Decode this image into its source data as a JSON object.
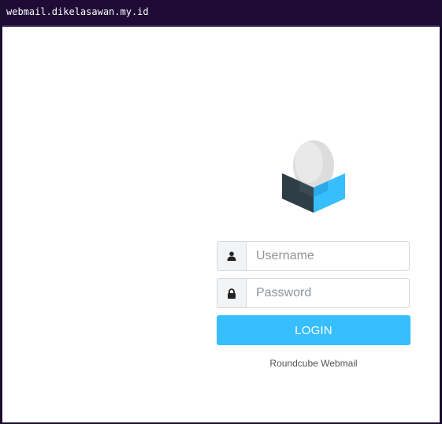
{
  "titlebar": {
    "url": "webmail.dikelasawan.my.id"
  },
  "login": {
    "username_placeholder": "Username",
    "username_value": "",
    "password_placeholder": "Password",
    "password_value": "",
    "button_label": "LOGIN"
  },
  "footer": {
    "product_name": "Roundcube Webmail"
  },
  "icons": {
    "user": "user-icon",
    "lock": "lock-icon",
    "logo": "roundcube-logo"
  },
  "colors": {
    "titlebar_bg": "#1e0b36",
    "accent": "#37beff",
    "logo_dark": "#2f3e46",
    "logo_light_blue": "#37beff",
    "logo_sphere": "#e0e0e0"
  }
}
